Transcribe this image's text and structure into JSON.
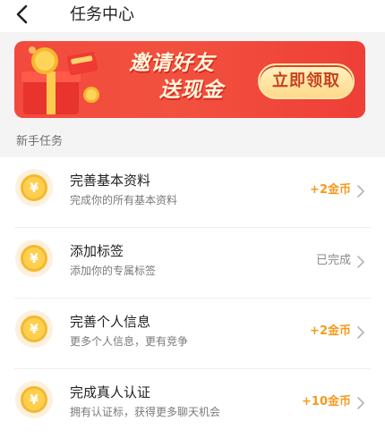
{
  "header": {
    "title": "任务中心"
  },
  "banner": {
    "line1": "邀请好友",
    "line2": "送现金",
    "button_label": "立即领取"
  },
  "section": {
    "title": "新手任务"
  },
  "coin": {
    "symbol": "¥"
  },
  "tasks": [
    {
      "title": "完善基本资料",
      "desc": "完成你的所有基本资料",
      "reward": "+2金币",
      "status": "reward"
    },
    {
      "title": "添加标签",
      "desc": "添加你的专属标签",
      "reward": "已完成",
      "status": "done"
    },
    {
      "title": "完善个人信息",
      "desc": "更多个人信息，更有竞争",
      "reward": "+2金币",
      "status": "reward"
    },
    {
      "title": "完成真人认证",
      "desc": "拥有认证标，获得更多聊天机会",
      "reward": "+10金币",
      "status": "reward"
    }
  ],
  "colors": {
    "reward": "#f59a1c",
    "done": "#8b8b8b",
    "banner": "#f24a3e",
    "coin": "#f5b82e"
  },
  "icons": {
    "back": "back-arrow-icon",
    "chevron": "chevron-right-icon",
    "coin": "coin-icon",
    "gift": "gift-box-icon"
  }
}
